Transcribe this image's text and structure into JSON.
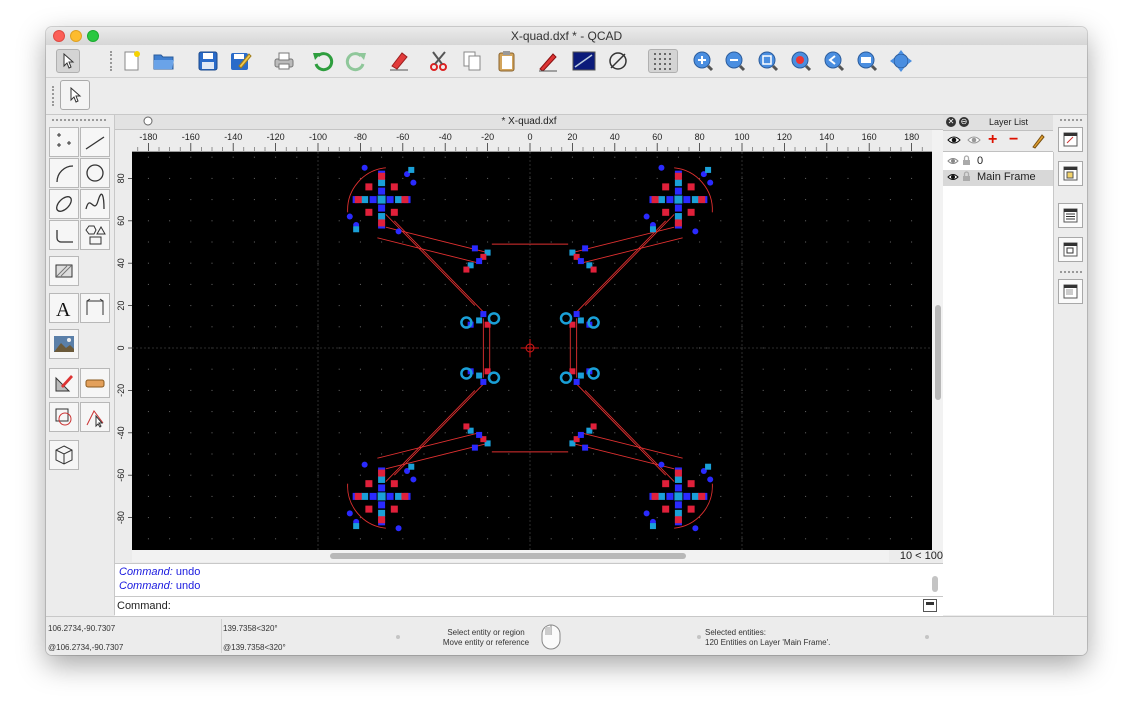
{
  "window": {
    "title": "X-quad.dxf * - QCAD"
  },
  "toolbar": {
    "buttons": [
      "select-arrow",
      "new-file",
      "open-file",
      "save-file",
      "save-as",
      "print-preview",
      "undo",
      "redo",
      "eraser",
      "cut",
      "copy",
      "paste",
      "pen",
      "block-image",
      "circle-slash",
      "grid-toggle",
      "zoom-in",
      "zoom-out",
      "zoom-auto",
      "zoom-previous",
      "zoom-window",
      "zoom-pan",
      "zoom-move"
    ]
  },
  "document": {
    "tab_title": "* X-quad.dxf",
    "hruler_labels": [
      "-180",
      "-160",
      "-140",
      "-120",
      "-100",
      "-80",
      "-60",
      "-40",
      "-20",
      "0",
      "20",
      "40",
      "60",
      "80",
      "100",
      "120",
      "140",
      "160",
      "180"
    ],
    "vruler_labels": [
      "80",
      "60",
      "40",
      "20",
      "0",
      "-20",
      "-40",
      "-60",
      "-80"
    ],
    "zoom_indicator": "10 < 100"
  },
  "command": {
    "history": [
      {
        "label": "Command:",
        "value": " undo"
      },
      {
        "label": "Command:",
        "value": " undo"
      }
    ],
    "prompt": "Command:"
  },
  "layers": {
    "title": "Layer List",
    "items": [
      {
        "name": "0"
      },
      {
        "name": "Main Frame"
      }
    ]
  },
  "status": {
    "abs_cartesian": "106.2734,-90.7307",
    "rel_cartesian": "@106.2734,-90.7307",
    "abs_polar": "139.7358<320°",
    "rel_polar": "@139.7358<320°",
    "mouse_left": "Select entity or region",
    "mouse_right": "Move entity or reference",
    "selection_title": "Selected entities:",
    "selection_detail": "120 Entities on Layer 'Main Frame'."
  },
  "colors": {
    "canvas_bg": "#000000",
    "frame_line": "#e03030",
    "pad_blue": "#2a2aff",
    "pad_cyan": "#1aa0d8",
    "pad_red": "#e0203a"
  }
}
